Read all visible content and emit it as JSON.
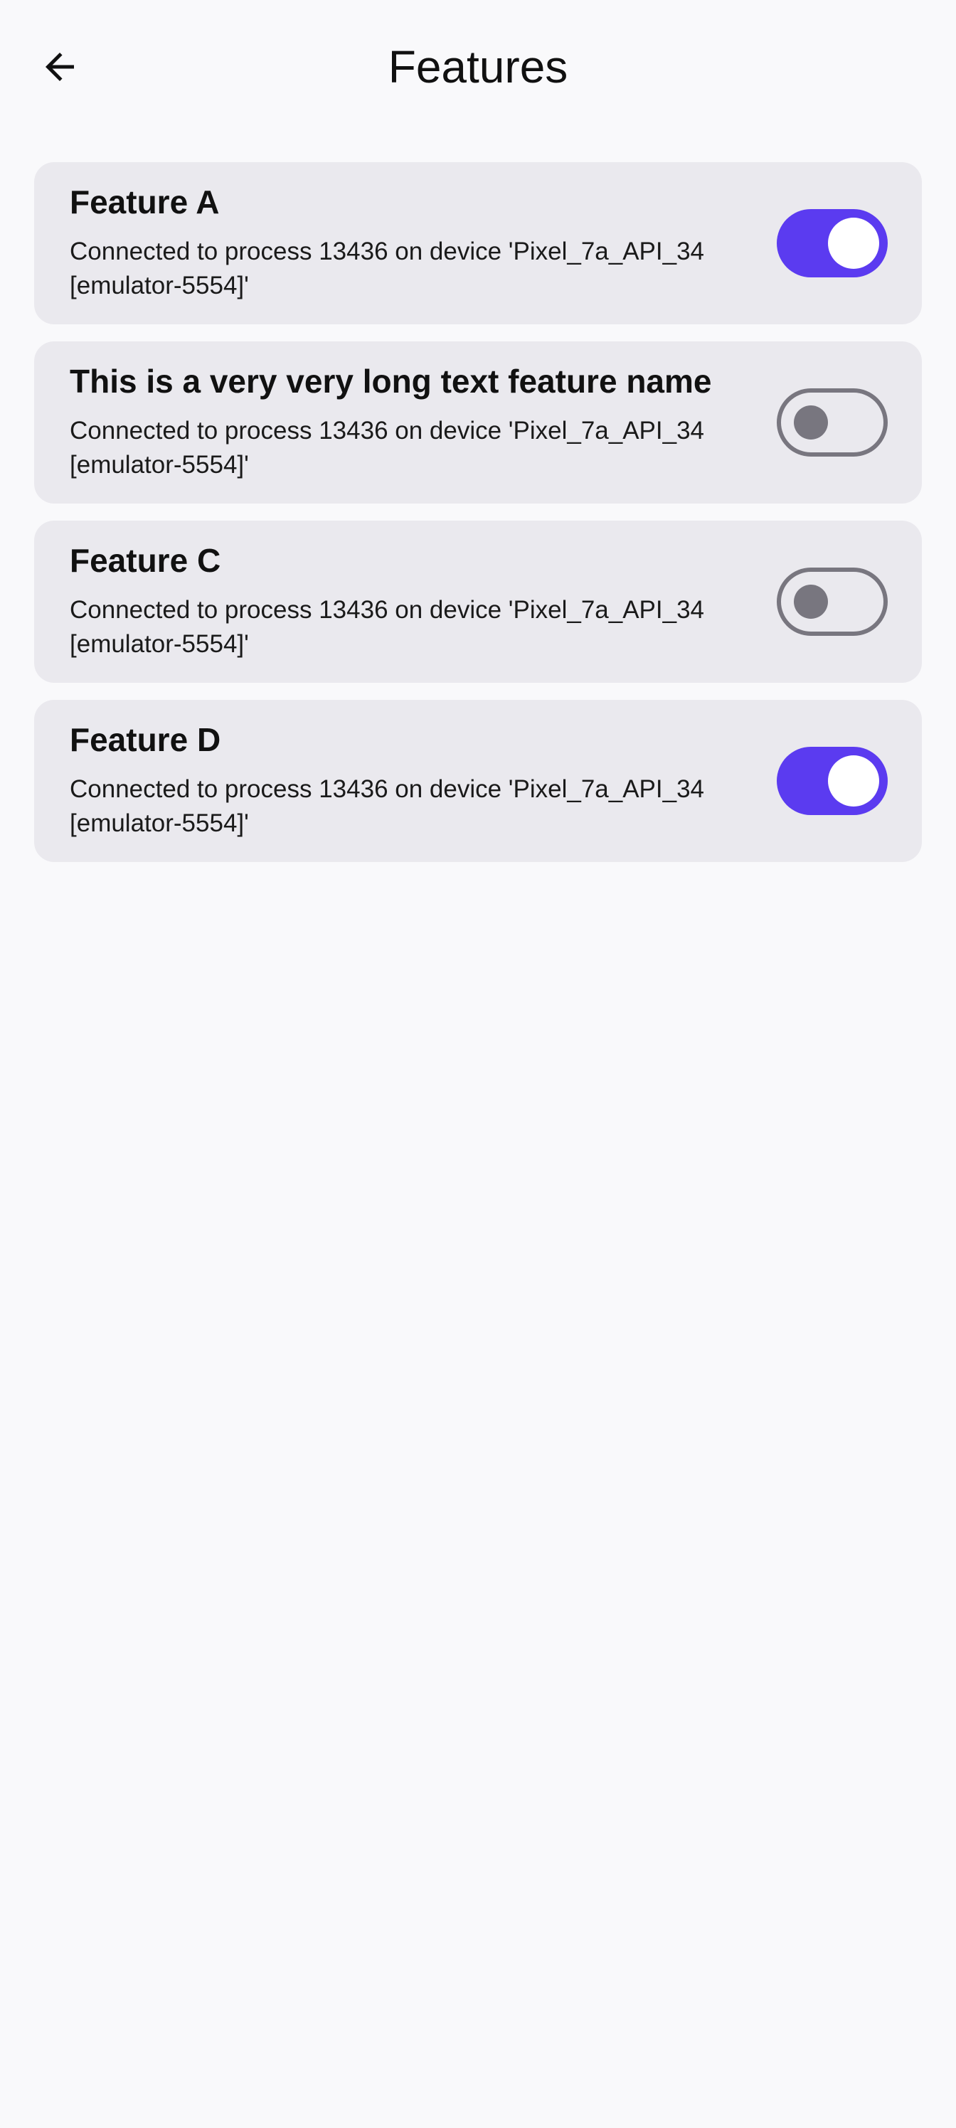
{
  "header": {
    "title": "Features",
    "back_icon": "arrow-back-icon"
  },
  "colors": {
    "background": "#f9f9fb",
    "card": "#eae9ee",
    "accent": "#5b3bf0",
    "switch_off": "#78767f"
  },
  "features": [
    {
      "name": "Feature A",
      "description": "Connected to process 13436 on device 'Pixel_7a_API_34 [emulator-5554]'",
      "enabled": true
    },
    {
      "name": "This is a very very long text feature name",
      "description": "Connected to process 13436 on device 'Pixel_7a_API_34 [emulator-5554]'",
      "enabled": false
    },
    {
      "name": "Feature C",
      "description": "Connected to process 13436 on device 'Pixel_7a_API_34 [emulator-5554]'",
      "enabled": false
    },
    {
      "name": "Feature D",
      "description": "Connected to process 13436 on device 'Pixel_7a_API_34 [emulator-5554]'",
      "enabled": true
    }
  ]
}
